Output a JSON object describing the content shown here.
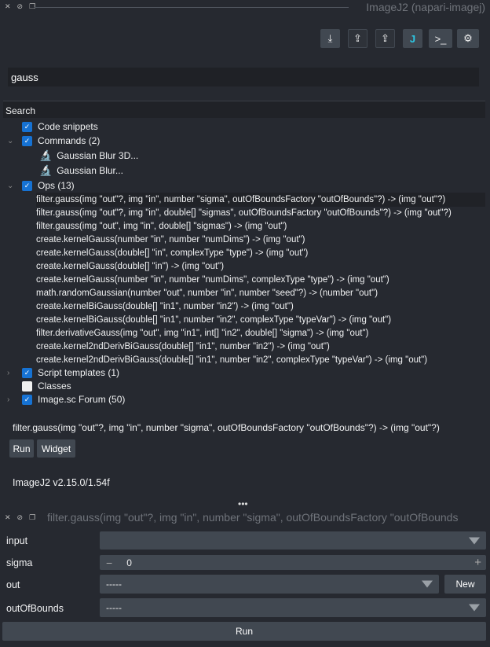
{
  "window": {
    "title": "ImageJ2 (napari-imagej)"
  },
  "toolbar": {
    "icons": [
      "export-to-imagej-icon",
      "import-from-imagej-icon",
      "import-details-icon",
      "imagej-gui-icon",
      "repl-icon",
      "settings-icon"
    ]
  },
  "search": {
    "value": "gauss",
    "header": "Search"
  },
  "tree": {
    "code_snippets": "Code snippets",
    "commands": "Commands (2)",
    "command_items": [
      "Gaussian Blur 3D...",
      "Gaussian Blur..."
    ],
    "ops": "Ops (13)",
    "op_items": [
      "filter.gauss(img \"out\"?, img \"in\", number \"sigma\", outOfBoundsFactory \"outOfBounds\"?) -> (img \"out\"?)",
      "filter.gauss(img \"out\"?, img \"in\", double[] \"sigmas\", outOfBoundsFactory \"outOfBounds\"?) -> (img \"out\"?)",
      "filter.gauss(img \"out\", img \"in\", double[] \"sigmas\") -> (img \"out\")",
      "create.kernelGauss(number \"in\", number \"numDims\") -> (img \"out\")",
      "create.kernelGauss(double[] \"in\", complexType \"type\") -> (img \"out\")",
      "create.kernelGauss(double[] \"in\") -> (img \"out\")",
      "create.kernelGauss(number \"in\", number \"numDims\", complexType \"type\") -> (img \"out\")",
      "math.randomGaussian(number \"out\", number \"in\", number \"seed\"?) -> (number \"out\")",
      "create.kernelBiGauss(double[] \"in1\", number \"in2\") -> (img \"out\")",
      "create.kernelBiGauss(double[] \"in1\", number \"in2\", complexType \"typeVar\") -> (img \"out\")",
      "filter.derivativeGauss(img \"out\", img \"in1\", int[] \"in2\", double[] \"sigma\") -> (img \"out\")",
      "create.kernel2ndDerivBiGauss(double[] \"in1\", number \"in2\") -> (img \"out\")",
      "create.kernel2ndDerivBiGauss(double[] \"in1\", number \"in2\", complexType \"typeVar\") -> (img \"out\")"
    ],
    "script_templates": "Script templates (1)",
    "classes": "Classes",
    "forum": "Image.sc Forum (50)"
  },
  "selection": {
    "text": "filter.gauss(img \"out\"?, img \"in\", number \"sigma\", outOfBoundsFactory \"outOfBounds\"?) -> (img \"out\"?)",
    "run": "Run",
    "widget": "Widget"
  },
  "version": "ImageJ2 v2.15.0/1.54f",
  "widget": {
    "title": "filter.gauss(img \"out\"?, img \"in\", number \"sigma\", outOfBoundsFactory \"outOfBounds",
    "input_label": "input",
    "input_value": "",
    "sigma_label": "sigma",
    "sigma_value": "0",
    "out_label": "out",
    "out_value": "-----",
    "new": "New",
    "oob_label": "outOfBounds",
    "oob_value": "-----",
    "run": "Run"
  },
  "colors": {
    "background": "#262930",
    "checkbox": "#1672d3",
    "field": "#414851",
    "command_icon": "#d89a1a"
  }
}
